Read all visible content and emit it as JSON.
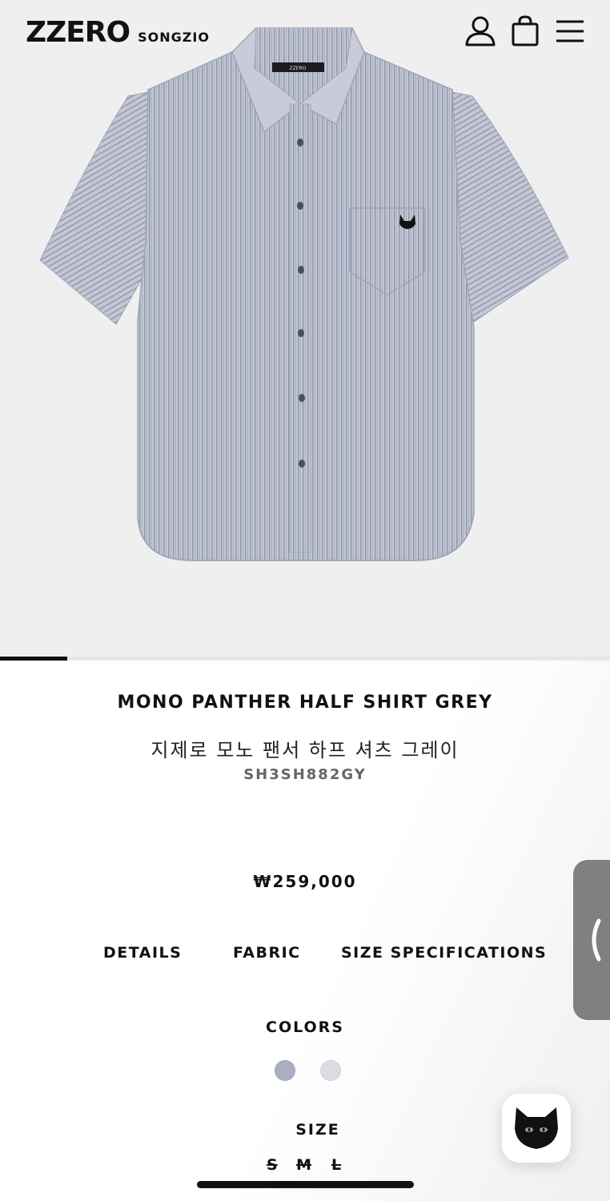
{
  "header": {
    "logo_main": "ZZERO",
    "logo_sub": "SONGZIO",
    "icons": [
      "user-icon",
      "shopping-bag-icon",
      "hamburger-menu-icon"
    ]
  },
  "gallery": {
    "image_label": "ZZERO",
    "progress_fraction": 0.11
  },
  "product": {
    "name_en": "MONO PANTHER HALF SHIRT GREY",
    "name_kr": "지제로 모노 팬서 하프 셔츠 그레이",
    "sku": "SH3SH882GY",
    "price": "₩259,000"
  },
  "tabs": [
    "DETAILS",
    "FABRIC",
    "SIZE SPECIFICATIONS"
  ],
  "colors": {
    "label": "COLORS",
    "swatches": [
      "#a9afbf",
      "#dcdde3"
    ]
  },
  "size": {
    "label": "SIZE",
    "options": [
      "S",
      "M",
      "L"
    ]
  },
  "side_tab_icon": "chevron-left-icon",
  "chat_icon": "panther-head-icon",
  "colors_theme": {
    "accent": "#111111",
    "shirt": "#b7bccb",
    "stripe": "#8c93a8"
  }
}
